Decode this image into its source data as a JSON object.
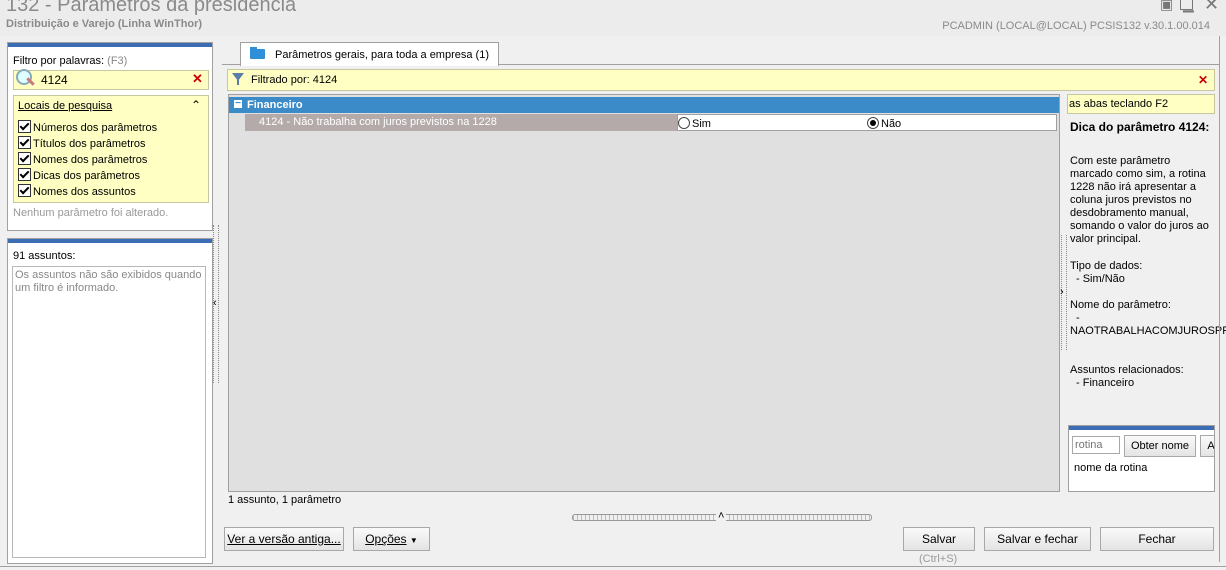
{
  "window": {
    "title": "132 - Parâmetros da presidência",
    "subtitle": "Distribuição e Varejo (Linha WinThor)",
    "user_info": "PCADMIN (LOCAL@LOCAL)   PCSIS132  v.30.1.00.014"
  },
  "filter": {
    "label": "Filtro por palavras:",
    "shortcut": "(F3)",
    "value": "4124",
    "locations_header": "Locais de pesquisa",
    "locations": [
      "Números dos parâmetros",
      "Títulos dos parâmetros",
      "Nomes dos parâmetros",
      "Dicas dos parâmetros",
      "Nomes dos assuntos"
    ],
    "status": "Nenhum parâmetro foi alterado."
  },
  "subjects": {
    "title": "91 assuntos:",
    "message": "Os assuntos não são exibidos quando um filtro é informado."
  },
  "tab": {
    "label": "Parâmetros gerais, para toda a empresa  (1)"
  },
  "filter_bar": {
    "text": "Filtrado por: 4124"
  },
  "grid": {
    "group": "Financeiro",
    "row": {
      "label": "4124 - Não trabalha com juros previstos na 1228",
      "option_yes": "Sim",
      "option_no": "Não",
      "selected": "Não"
    },
    "footer": "1 assunto, 1 parâmetro"
  },
  "tip": {
    "banner": "as abas teclando F2",
    "title": "Dica do parâmetro 4124:",
    "body": "Com este parâmetro marcado como sim, a rotina 1228 não irá apresentar a coluna juros previstos no desdobramento manual, somando o valor do juros ao valor principal.",
    "type_label": "Tipo de dados:",
    "type_value": "- Sim/Não",
    "name_label": "Nome do parâmetro:",
    "name_dash": "-",
    "name_value": "NAOTRABALHACOMJUROSPR",
    "related_label": "Assuntos relacionados:",
    "related_value": "- Financeiro"
  },
  "routine": {
    "placeholder": "rotina",
    "get_name_button": "Obter nome",
    "extra_button": "A",
    "name_label": "nome da rotina"
  },
  "footer": {
    "old_version_button": "Ver a versão antiga...",
    "options_button": "Opções",
    "save_button": "Salvar",
    "save_shortcut": "(Ctrl+S)",
    "save_close_button": "Salvar e fechar",
    "close_button": "Fechar"
  }
}
